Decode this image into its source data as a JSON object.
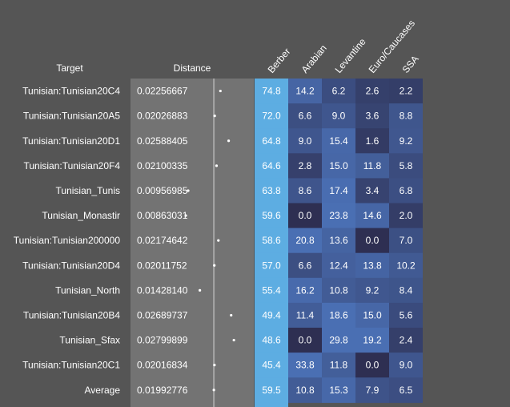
{
  "chart_data": {
    "type": "table",
    "title": "",
    "headers": {
      "target": "Target",
      "distance": "Distance",
      "components": [
        "Berber",
        "Arabian",
        "Levantine",
        "Euro/Caucases",
        "SSA"
      ]
    },
    "rows": [
      {
        "target": "Tunisian:Tunisian20C4",
        "distance": "0.02256667",
        "values": [
          "74.8",
          "14.2",
          "6.2",
          "2.6",
          "2.2"
        ]
      },
      {
        "target": "Tunisian:Tunisian20A5",
        "distance": "0.02026883",
        "values": [
          "72.0",
          "6.6",
          "9.0",
          "3.6",
          "8.8"
        ]
      },
      {
        "target": "Tunisian:Tunisian20D1",
        "distance": "0.02588405",
        "values": [
          "64.8",
          "9.0",
          "15.4",
          "1.6",
          "9.2"
        ]
      },
      {
        "target": "Tunisian:Tunisian20F4",
        "distance": "0.02100335",
        "values": [
          "64.6",
          "2.8",
          "15.0",
          "11.8",
          "5.8"
        ]
      },
      {
        "target": "Tunisian_Tunis",
        "distance": "0.00956985",
        "values": [
          "63.8",
          "8.6",
          "17.4",
          "3.4",
          "6.8"
        ]
      },
      {
        "target": "Tunisian_Monastir",
        "distance": "0.00863031",
        "values": [
          "59.6",
          "0.0",
          "23.8",
          "14.6",
          "2.0"
        ]
      },
      {
        "target": "Tunisian:Tunisian200000",
        "distance": "0.02174642",
        "values": [
          "58.6",
          "20.8",
          "13.6",
          "0.0",
          "7.0"
        ]
      },
      {
        "target": "Tunisian:Tunisian20D4",
        "distance": "0.02011752",
        "values": [
          "57.0",
          "6.6",
          "12.4",
          "13.8",
          "10.2"
        ]
      },
      {
        "target": "Tunisian_North",
        "distance": "0.01428140",
        "values": [
          "55.4",
          "16.2",
          "10.8",
          "9.2",
          "8.4"
        ]
      },
      {
        "target": "Tunisian:Tunisian20B4",
        "distance": "0.02689737",
        "values": [
          "49.4",
          "11.4",
          "18.6",
          "15.0",
          "5.6"
        ]
      },
      {
        "target": "Tunisian_Sfax",
        "distance": "0.02799899",
        "values": [
          "48.6",
          "0.0",
          "29.8",
          "19.2",
          "2.4"
        ]
      },
      {
        "target": "Tunisian:Tunisian20C1",
        "distance": "0.02016834",
        "values": [
          "45.4",
          "33.8",
          "11.8",
          "0.0",
          "9.0"
        ]
      },
      {
        "target": "Average",
        "distance": "0.01992776",
        "values": [
          "59.5",
          "10.8",
          "15.3",
          "7.9",
          "6.5"
        ]
      }
    ],
    "distance_reference": 0.01992776,
    "colors": {
      "background": "#555555",
      "distance_cell": "#737373",
      "berber_cell": "#5dade2",
      "cell_high": "#4a6fb3",
      "cell_low": "#2e2f52",
      "marker": "#ffffff",
      "reference_line": "#a6a6a6"
    }
  }
}
